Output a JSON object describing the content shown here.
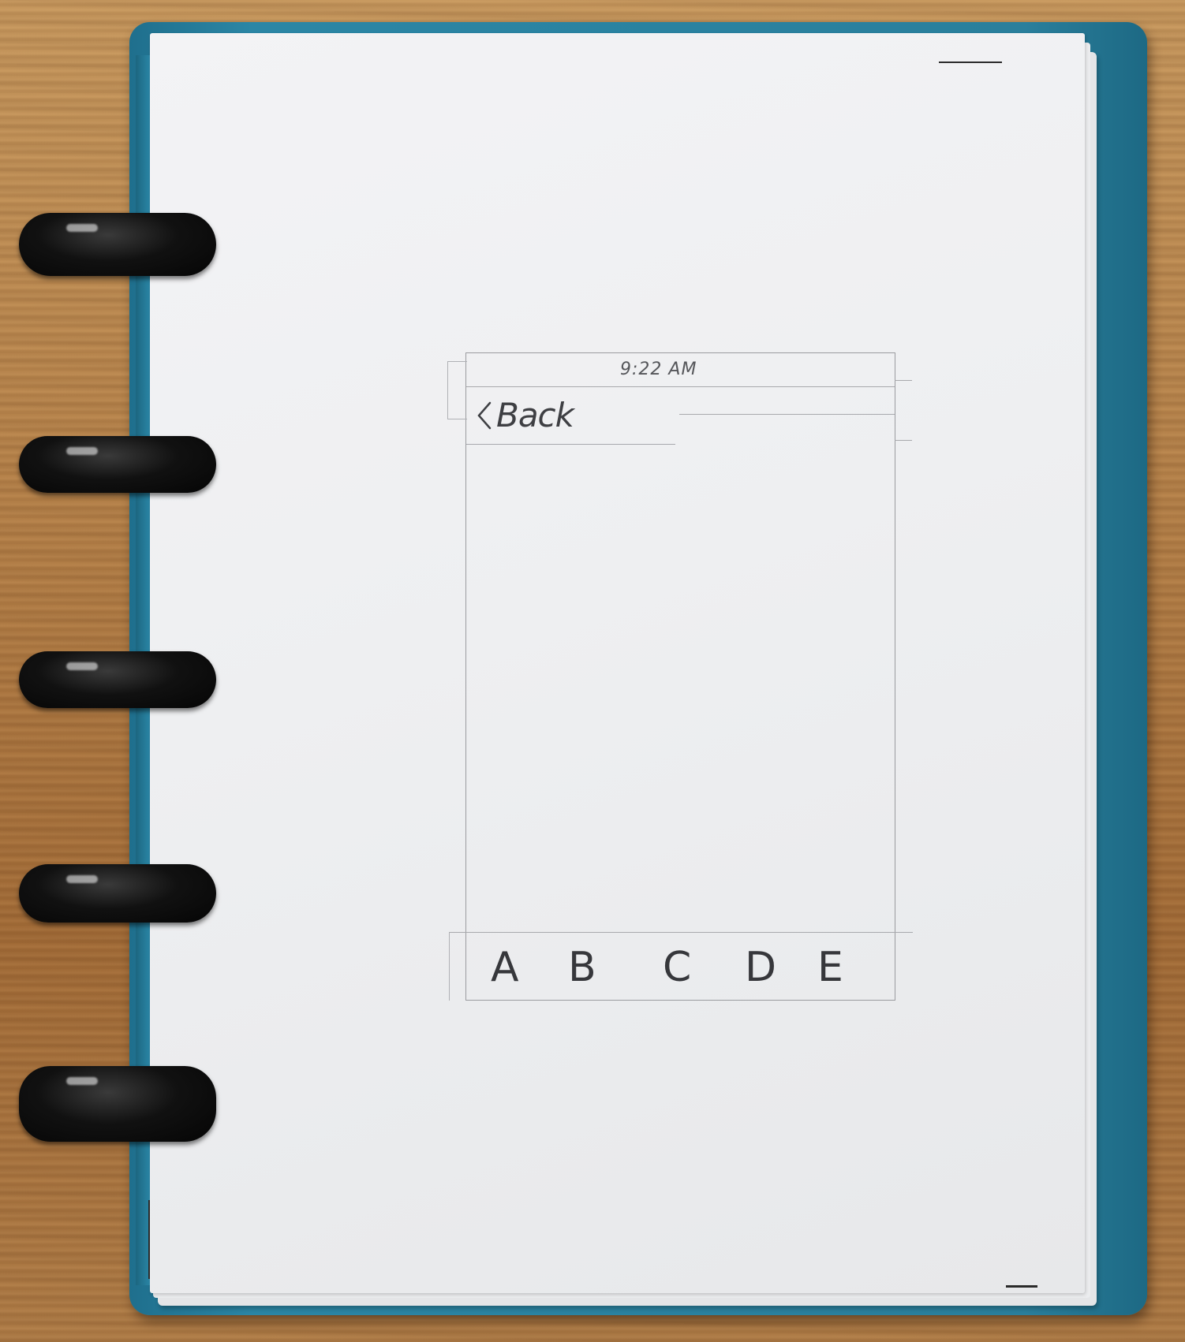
{
  "wireframe": {
    "status_bar": {
      "time": "9:22 AM"
    },
    "nav_bar": {
      "back_label": "Back"
    },
    "tab_bar": {
      "tabs": [
        {
          "label": "A"
        },
        {
          "label": "B"
        },
        {
          "label": "C"
        },
        {
          "label": "D"
        },
        {
          "label": "E"
        }
      ]
    }
  }
}
